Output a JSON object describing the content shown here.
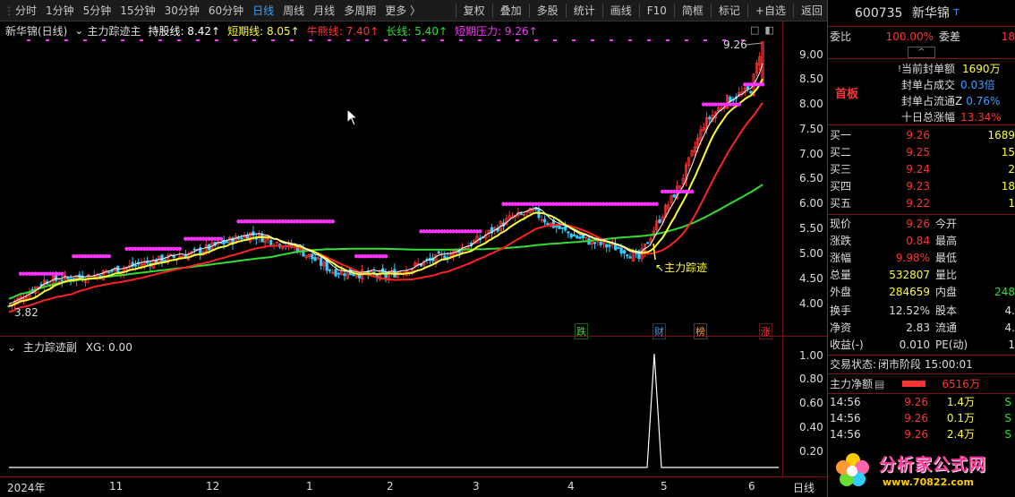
{
  "toolbar": {
    "periods": [
      "分时",
      "1分钟",
      "5分钟",
      "15分钟",
      "30分钟",
      "60分钟",
      "日线",
      "周线",
      "月线",
      "多周期",
      "更多 〉"
    ],
    "active_period": "日线",
    "tools": [
      "复权",
      "叠加",
      "多股",
      "统计",
      "画线",
      "F10",
      "简框",
      "标记",
      "+自选",
      "返回"
    ]
  },
  "main_chart": {
    "stock_label": "新华锦(日线)",
    "indicator_name": "主力踪迹主",
    "ma_hold": "持股线: 8.42↑",
    "ma_short": "短期线: 8.05↑",
    "ma_bull": "牛熊线: 7.40↑",
    "ma_long": "长线: 5.40↑",
    "ma_pressure": "短期压力: 9.26↑",
    "high_label": "9.26",
    "low_label": "3.82",
    "annotation": "主力踪迹",
    "event_tags": [
      "跌",
      "财",
      "榜",
      "涨"
    ],
    "price_ticks": [
      "9.00",
      "8.50",
      "8.00",
      "7.50",
      "7.00",
      "6.50",
      "6.00",
      "5.50",
      "5.00",
      "4.50",
      "4.00"
    ]
  },
  "sub_chart": {
    "indicator_name": "主力踪迹副",
    "xg_value": "XG: 0.00",
    "ticks": [
      "1.00",
      "0.80",
      "0.60",
      "0.40",
      "0.20"
    ]
  },
  "time_axis": {
    "labels": [
      "2024年",
      "11",
      "12",
      "1",
      "2",
      "3",
      "4",
      "5",
      "6"
    ],
    "period_button": "日线"
  },
  "quote": {
    "code": "600735",
    "name": "新华锦",
    "weibi_label": "委比",
    "weibi_value": "100.00%",
    "weicha_label": "委差",
    "weicha_value": "18",
    "board_tag": "首板",
    "seal_amount_label": "当前封单额",
    "seal_amount_value": "1690万",
    "seal_deal_label": "封单占成交",
    "seal_deal_value": "0.03倍",
    "seal_float_label": "封单占流通Z",
    "seal_float_value": "0.76%",
    "ten_day_label": "十日总涨幅",
    "ten_day_value": "13.34%",
    "bids": [
      {
        "label": "买一",
        "price": "9.26",
        "vol": "1689"
      },
      {
        "label": "买二",
        "price": "9.25",
        "vol": "15"
      },
      {
        "label": "买三",
        "price": "9.24",
        "vol": "2"
      },
      {
        "label": "买四",
        "price": "9.23",
        "vol": "18"
      },
      {
        "label": "买五",
        "price": "9.22",
        "vol": "1"
      }
    ],
    "stats": [
      {
        "l1": "现价",
        "v1": "9.26",
        "l2": "今开",
        "v2": ""
      },
      {
        "l1": "涨跌",
        "v1": "0.84",
        "l2": "最高",
        "v2": ""
      },
      {
        "l1": "涨幅",
        "v1": "9.98%",
        "l2": "最低",
        "v2": ""
      },
      {
        "l1": "总量",
        "v1": "532807",
        "l2": "量比",
        "v2": ""
      },
      {
        "l1": "外盘",
        "v1": "284659",
        "l2": "内盘",
        "v2": "248"
      }
    ],
    "stats2": [
      {
        "l1": "换手",
        "v1": "12.52%",
        "l2": "股本",
        "v2": "4."
      },
      {
        "l1": "净资",
        "v1": "2.83",
        "l2": "流通",
        "v2": "4."
      },
      {
        "l1": "收益(-)",
        "v1": "0.010",
        "l2": "PE(动)",
        "v2": "1"
      }
    ],
    "trade_status_label": "交易状态:",
    "trade_status_value": "闭市阶段 15:00:01",
    "main_net_label": "主力净额",
    "main_net_value": "6516万",
    "ticks": [
      {
        "time": "14:56",
        "price": "9.26",
        "vol": "1.4万",
        "side": "S"
      },
      {
        "time": "14:56",
        "price": "9.26",
        "vol": "0.1万",
        "side": "S"
      },
      {
        "time": "14:56",
        "price": "9.26",
        "vol": "2.4万",
        "side": "S"
      }
    ]
  },
  "watermark": {
    "text": "分析家公式网",
    "url": "www.70822.com"
  },
  "colors": {
    "up": "#ff3333",
    "down": "#33dd33",
    "short_line": "#ffff33",
    "pressure": "#ff33ff",
    "long_line": "#33dd33",
    "grid_border": "#7a1010"
  }
}
